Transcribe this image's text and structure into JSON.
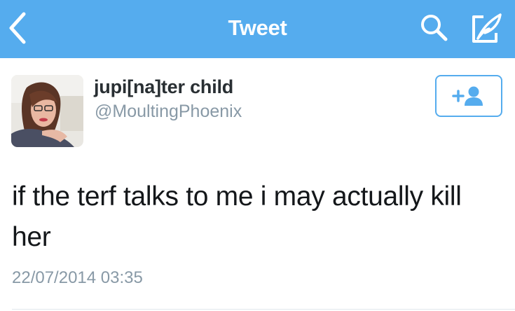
{
  "navbar": {
    "title": "Tweet",
    "back_icon": "chevron-left-icon",
    "search_icon": "search-icon",
    "compose_icon": "compose-quill-icon",
    "color": "#55acee"
  },
  "tweet": {
    "display_name": "jupi[na]ter child",
    "handle": "@MoultingPhoenix",
    "follow_icon": "add-user-icon",
    "text": "if the terf talks to me i may actually kill her",
    "timestamp": "22/07/2014 03:35"
  },
  "colors": {
    "accent": "#55acee",
    "text": "#14171a",
    "secondary": "#8899a6"
  }
}
